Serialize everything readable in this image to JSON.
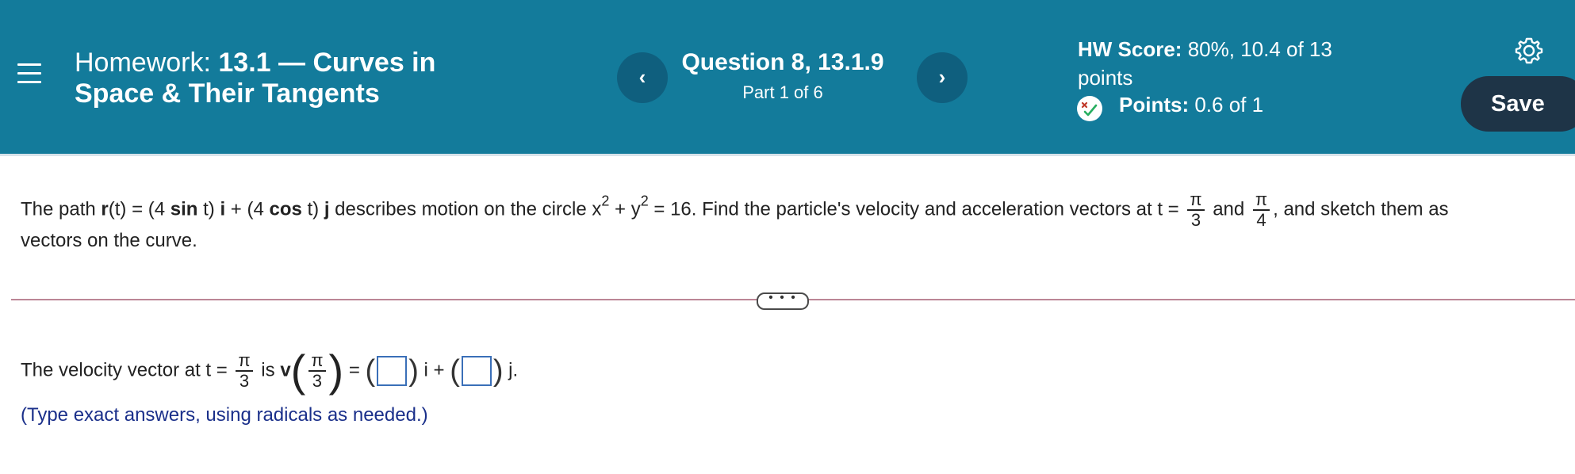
{
  "header": {
    "menu_icon": "hamburger-icon",
    "title_prefix": "Homework:",
    "title_bold_line1": "13.1 — Curves in",
    "title_bold_line2": "Space & Their Tangents",
    "prev_label": "‹",
    "next_label": "›",
    "question_title": "Question 8, 13.1.9",
    "question_part": "Part 1 of 6",
    "hw_score_label": "HW Score:",
    "hw_score_value": "80%, 10.4 of 13",
    "hw_score_line2": "points",
    "points_label": "Points:",
    "points_value": "0.6 of 1",
    "settings_icon": "gear-icon",
    "save_label": "Save",
    "colors": {
      "header_bg": "#137b9b",
      "nav_btn": "#0f5f7e",
      "save_btn": "#1e3447"
    }
  },
  "problem": {
    "t1": "The path ",
    "r": "r",
    "t2": "(t) = (4 ",
    "sin": "sin",
    "t3": " t) ",
    "i1": "i",
    "t4": " + (4 ",
    "cos": "cos",
    "t5": " t) ",
    "j1": "j",
    "t6": " describes motion on the circle x",
    "exp1": "2",
    "t7": " + y",
    "exp2": "2",
    "t8": " = 16. Find the particle's velocity and acceleration vectors at t = ",
    "frac1_num": "π",
    "frac1_den": "3",
    "t9": " and ",
    "frac2_num": "π",
    "frac2_den": "4",
    "t10": ", and sketch them as",
    "line2": "vectors on the curve."
  },
  "expand_label": "• • •",
  "answer": {
    "t1": "The velocity vector at t = ",
    "frac_num": "π",
    "frac_den": "3",
    "t2": " is ",
    "v": "v",
    "inner_num": "π",
    "inner_den": "3",
    "eq": " = ",
    "i": " i + ",
    "j": " j.",
    "hint": "(Type exact answers, using radicals as needed.)"
  }
}
